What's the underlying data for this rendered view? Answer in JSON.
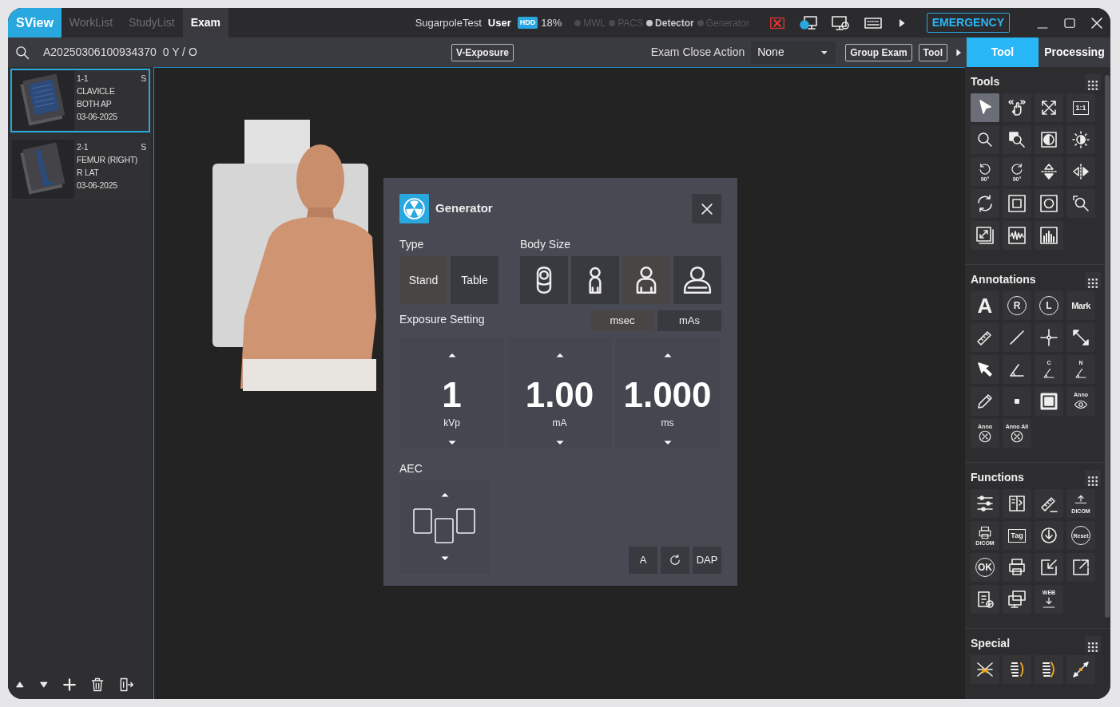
{
  "app_name": "SView",
  "nav_tabs": [
    {
      "label": "WorkList",
      "selected": false
    },
    {
      "label": "StudyList",
      "selected": false
    },
    {
      "label": "Exam",
      "selected": true
    }
  ],
  "status": {
    "site": "SugarpoleTest",
    "user": "User",
    "disk_badge": "HDD",
    "disk_usage": "18%"
  },
  "connections": [
    {
      "label": "MWL",
      "on": false
    },
    {
      "label": "PACS",
      "on": false
    },
    {
      "label": "Detector",
      "on": true
    },
    {
      "label": "Generator",
      "on": false
    }
  ],
  "emergency": "EMERGENCY",
  "exam_bar": {
    "patient_id": "A20250306100934370",
    "patient_info": "0 Y / O",
    "v_exposure": "V-Exposure",
    "close_action_label": "Exam Close Action",
    "close_action_value": "None",
    "group_exam": "Group Exam",
    "tool_button": "Tool"
  },
  "panel_tabs": [
    {
      "label": "Tool",
      "selected": true
    },
    {
      "label": "Processing",
      "selected": false
    }
  ],
  "series": [
    {
      "number": "1-1",
      "flag": "S",
      "lines": [
        "CLAVICLE",
        "BOTH AP"
      ],
      "date": "03-06-2025",
      "selected": true
    },
    {
      "number": "2-1",
      "flag": "S",
      "lines": [
        "FEMUR (RIGHT)",
        "R LAT"
      ],
      "date": "03-06-2025",
      "selected": false
    }
  ],
  "generator": {
    "title": "Generator",
    "type_label": "Type",
    "types": [
      {
        "label": "Stand",
        "selected": true
      },
      {
        "label": "Table",
        "selected": false
      }
    ],
    "body_size_label": "Body Size",
    "body_sizes": [
      {
        "selected": false
      },
      {
        "selected": false
      },
      {
        "selected": true
      },
      {
        "selected": false
      }
    ],
    "exposure_label": "Exposure Setting",
    "modes": [
      {
        "label": "msec",
        "selected": true
      },
      {
        "label": "mAs",
        "selected": false
      }
    ],
    "settings": [
      {
        "value": "1",
        "unit": "kVp"
      },
      {
        "value": "1.00",
        "unit": "mA"
      },
      {
        "value": "1.000",
        "unit": "ms"
      }
    ],
    "aec_label": "AEC",
    "actions": [
      {
        "kind": "text",
        "label": "A"
      },
      {
        "kind": "icon"
      },
      {
        "kind": "text",
        "label": "DAP"
      }
    ]
  },
  "tool_sections": [
    {
      "title": "Tools",
      "items": [
        {
          "selected": true
        },
        {
          "selected": false
        },
        {
          "selected": false
        },
        {
          "selected": false,
          "label": "1:1"
        },
        {
          "selected": false
        },
        {
          "selected": false
        },
        {
          "selected": false
        },
        {
          "selected": false
        },
        {
          "selected": false,
          "label": "90°"
        },
        {
          "selected": false,
          "label": "90°"
        },
        {
          "selected": false
        },
        {
          "selected": false
        },
        {
          "selected": false
        },
        {
          "selected": false
        },
        {
          "selected": false
        },
        {
          "selected": false
        },
        {
          "selected": false
        },
        {
          "selected": false
        },
        {
          "selected": false
        }
      ]
    },
    {
      "title": "Annotations",
      "items": [
        {
          "selected": false,
          "label": "A"
        },
        {
          "selected": false,
          "label": "R"
        },
        {
          "selected": false,
          "label": "L"
        },
        {
          "selected": false,
          "label": "Mark"
        },
        {
          "selected": false
        },
        {
          "selected": false
        },
        {
          "selected": false
        },
        {
          "selected": false
        },
        {
          "selected": false
        },
        {
          "selected": false
        },
        {
          "selected": false,
          "label": "C"
        },
        {
          "selected": false,
          "label": "N"
        },
        {
          "selected": false
        },
        {
          "selected": false
        },
        {
          "selected": false
        },
        {
          "selected": false,
          "label": "Anno"
        },
        {
          "selected": false,
          "label": "Anno"
        },
        {
          "selected": false,
          "label": "Anno All"
        }
      ]
    },
    {
      "title": "Functions",
      "items": [
        {
          "selected": false
        },
        {
          "selected": false
        },
        {
          "selected": false
        },
        {
          "selected": false,
          "label": "DICOM"
        },
        {
          "selected": false,
          "label": "DICOM"
        },
        {
          "selected": false,
          "label": "Tag"
        },
        {
          "selected": false
        },
        {
          "selected": false,
          "label": "Reset"
        },
        {
          "selected": false,
          "label": "OK"
        },
        {
          "selected": false
        },
        {
          "selected": false
        },
        {
          "selected": false
        },
        {
          "selected": false
        },
        {
          "selected": false
        },
        {
          "selected": false,
          "label": "WEB"
        }
      ]
    },
    {
      "title": "Special",
      "items": [
        {
          "selected": false
        },
        {
          "selected": false
        },
        {
          "selected": false
        },
        {
          "selected": false
        }
      ]
    }
  ]
}
